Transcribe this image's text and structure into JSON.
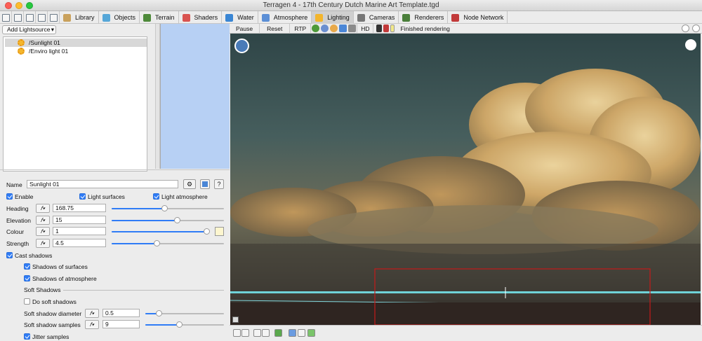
{
  "window": {
    "title": "Terragen 4 - 17th Century Dutch Marine Art Template.tgd"
  },
  "toolbar": {
    "tabs": [
      {
        "label": "Library",
        "icon": "library-icon",
        "color": "#c9a15c"
      },
      {
        "label": "Objects",
        "icon": "objects-icon",
        "color": "#56a7d8"
      },
      {
        "label": "Terrain",
        "icon": "terrain-icon",
        "color": "#4e8a3a"
      },
      {
        "label": "Shaders",
        "icon": "shaders-icon",
        "color": "#d9534f"
      },
      {
        "label": "Water",
        "icon": "water-icon",
        "color": "#3a86d4"
      },
      {
        "label": "Atmosphere",
        "icon": "atmosphere-icon",
        "color": "#5b8fd6"
      },
      {
        "label": "Lighting",
        "icon": "lighting-icon",
        "color": "#f3b52c"
      },
      {
        "label": "Cameras",
        "icon": "cameras-icon",
        "color": "#777777"
      },
      {
        "label": "Renderers",
        "icon": "renderers-icon",
        "color": "#4a7f3b"
      },
      {
        "label": "Node Network",
        "icon": "node-network-icon",
        "color": "#c23a3a"
      }
    ],
    "active_tab": "Lighting"
  },
  "lights": {
    "add_button": "Add Lightsource",
    "items": [
      {
        "label": "/Sunlight 01",
        "selected": true
      },
      {
        "label": "/Enviro light 01",
        "selected": false
      }
    ]
  },
  "params": {
    "name_label": "Name",
    "name_value": "Sunlight 01",
    "help_label": "?",
    "enable_label": "Enable",
    "light_surfaces_label": "Light surfaces",
    "light_atmosphere_label": "Light atmosphere",
    "heading_label": "Heading",
    "heading_value": "168.75",
    "heading_fraction": 0.47,
    "elevation_label": "Elevation",
    "elevation_value": "15",
    "elevation_fraction": 0.58,
    "colour_label": "Colour",
    "colour_value": "1",
    "colour_fraction": 0.98,
    "colour_swatch": "#fdf6cf",
    "strength_label": "Strength",
    "strength_value": "4.5",
    "strength_fraction": 0.4,
    "cast_shadows_label": "Cast shadows",
    "shadows_surfaces_label": "Shadows of surfaces",
    "shadows_atmosphere_label": "Shadows of atmosphere",
    "soft_shadows_heading": "Soft Shadows",
    "do_soft_shadows_label": "Do soft shadows",
    "soft_diameter_label": "Soft shadow diameter",
    "soft_diameter_value": "0.5",
    "soft_diameter_fraction": 0.17,
    "soft_samples_label": "Soft shadow samples",
    "soft_samples_value": "9",
    "soft_samples_fraction": 0.43,
    "jitter_label": "Jitter samples"
  },
  "render": {
    "pause_label": "Pause",
    "reset_label": "Reset",
    "rtp_label": "RTP",
    "hd_label": "HD",
    "status": "Finished rendering",
    "accent": "#2f7cf6",
    "crop_color": "#c41a1a"
  }
}
